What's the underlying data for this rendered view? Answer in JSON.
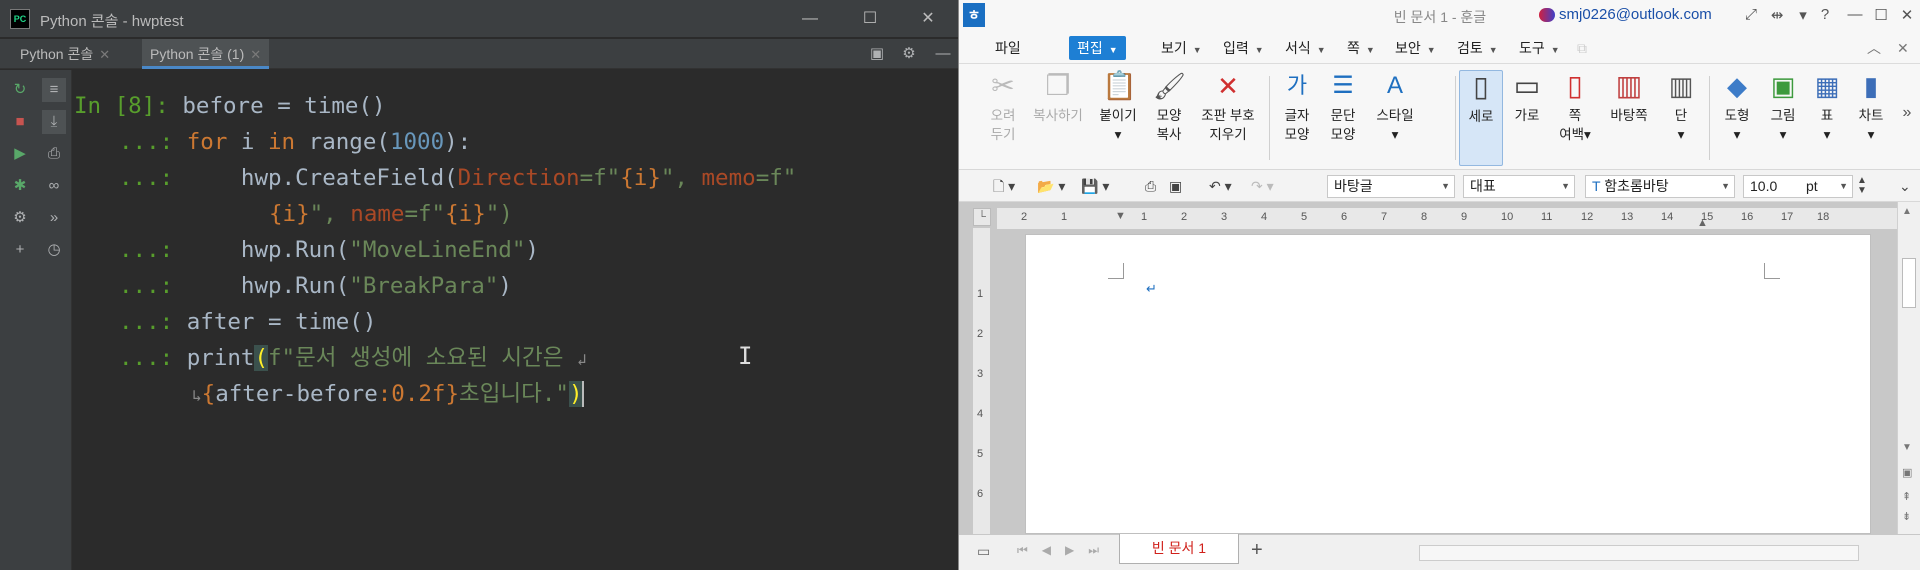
{
  "pycharm": {
    "window_title": "Python 콘솔 - hwptest",
    "tabs": [
      {
        "label": "Python 콘솔"
      },
      {
        "label": "Python 콘솔 (1)"
      }
    ],
    "prompt": "In [8]:",
    "cont": "...:",
    "code": {
      "l1": "before = time()",
      "l2_kw": "for",
      "l2_a": " i ",
      "l2_kw2": "in",
      "l2_b": " range(",
      "l2_num": "1000",
      "l2_c": "):",
      "l3_a": "hwp.CreateField(",
      "l3_p1": "Direction",
      "l3_b": "=f\"",
      "l3_c": "{i}",
      "l3_d": "\", ",
      "l3_p2": "memo",
      "l3_e": "=f\"",
      "l4_a": "{i}",
      "l4_b": "\", ",
      "l4_p3": "name",
      "l4_c": "=f\"",
      "l4_d": "{i}",
      "l4_e": "\")",
      "l5_a": "hwp.Run(",
      "l5_s": "\"MoveLineEnd\"",
      "l5_b": ")",
      "l6_a": "hwp.Run(",
      "l6_s": "\"BreakPara\"",
      "l6_b": ")",
      "l7": "after = time()",
      "l8_a": "print",
      "l8_p": "(",
      "l8_s": "f\"문서 생성에 소요된 시간은",
      "l9_a": "{",
      "l9_b": "after-before",
      "l9_c": ":0.2f",
      "l9_d": "}",
      "l9_e": "초입니다.\"",
      "l9_f": ")"
    }
  },
  "hwp": {
    "window_title": "빈 문서 1 - 훈글",
    "account": "smj0226@outlook.com",
    "menu": [
      "파일",
      "편집",
      "보기",
      "입력",
      "서식",
      "쪽",
      "보안",
      "검토",
      "도구"
    ],
    "ribbon": [
      {
        "l1": "오려",
        "l2": "두기"
      },
      {
        "l1": "복사하기",
        "l2": ""
      },
      {
        "l1": "붙이기",
        "l2": "▾"
      },
      {
        "l1": "모양",
        "l2": "복사"
      },
      {
        "l1": "조판 부호",
        "l2": "지우기"
      },
      {
        "l1": "글자",
        "l2": "모양"
      },
      {
        "l1": "문단",
        "l2": "모양"
      },
      {
        "l1": "스타일",
        "l2": "▾"
      },
      {
        "l1": "세로",
        "l2": ""
      },
      {
        "l1": "가로",
        "l2": ""
      },
      {
        "l1": "쪽",
        "l2": "여백▾"
      },
      {
        "l1": "바탕쪽",
        "l2": ""
      },
      {
        "l1": "단",
        "l2": "▾"
      },
      {
        "l1": "도형",
        "l2": "▾"
      },
      {
        "l1": "그림",
        "l2": "▾"
      },
      {
        "l1": "표",
        "l2": "▾"
      },
      {
        "l1": "차트",
        "l2": "▾"
      }
    ],
    "toolbar": {
      "style": "바탕글",
      "para": "대표",
      "font": "함초롬바탕",
      "size": "10.0",
      "unit": "pt"
    },
    "ruler_top": [
      "2",
      "1",
      "1",
      "2",
      "3",
      "4",
      "5",
      "6",
      "7",
      "8",
      "9",
      "10",
      "11",
      "12",
      "13",
      "14",
      "15",
      "16",
      "17",
      "18"
    ],
    "ruler_left": [
      "1",
      "2",
      "3",
      "4",
      "5",
      "6"
    ],
    "sheet_tab": "빈 문서 1",
    "add_sheet": "+"
  }
}
